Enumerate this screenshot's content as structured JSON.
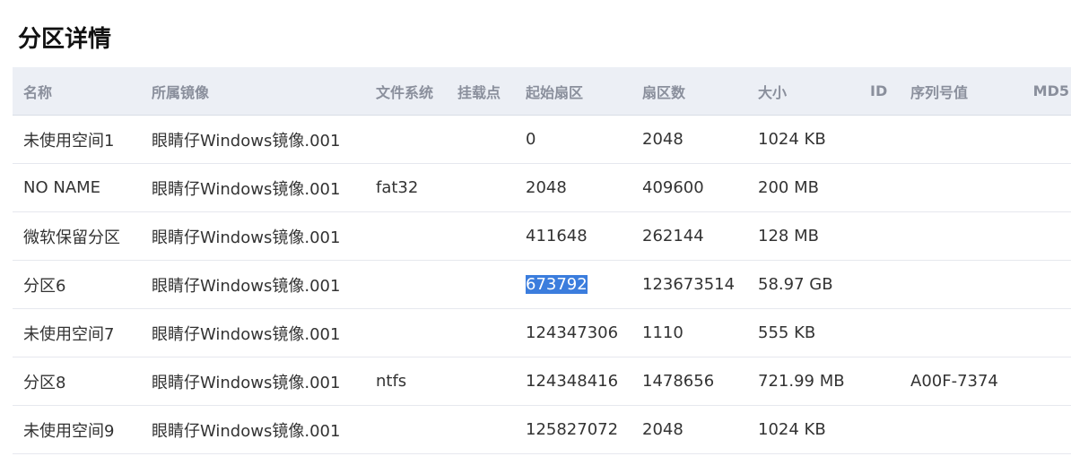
{
  "page": {
    "title": "分区详情"
  },
  "table": {
    "columns": [
      "名称",
      "所属镜像",
      "文件系统",
      "挂载点",
      "起始扇区",
      "扇区数",
      "大小",
      "ID",
      "序列号值",
      "MD5"
    ],
    "rows": [
      [
        "未使用空间1",
        "眼睛仔Windows镜像.001",
        "",
        "",
        "0",
        "2048",
        "1024 KB",
        "",
        "",
        ""
      ],
      [
        "NO NAME",
        "眼睛仔Windows镜像.001",
        "fat32",
        "",
        "2048",
        "409600",
        "200 MB",
        "",
        "",
        ""
      ],
      [
        "微软保留分区",
        "眼睛仔Windows镜像.001",
        "",
        "",
        "411648",
        "262144",
        "128 MB",
        "",
        "",
        ""
      ],
      [
        "分区6",
        "眼睛仔Windows镜像.001",
        "",
        "",
        "673792",
        "123673514",
        "58.97 GB",
        "",
        "",
        ""
      ],
      [
        "未使用空间7",
        "眼睛仔Windows镜像.001",
        "",
        "",
        "124347306",
        "1110",
        "555 KB",
        "",
        "",
        ""
      ],
      [
        "分区8",
        "眼睛仔Windows镜像.001",
        "ntfs",
        "",
        "124348416",
        "1478656",
        "721.99 MB",
        "",
        "A00F-7374",
        ""
      ],
      [
        "未使用空间9",
        "眼睛仔Windows镜像.001",
        "",
        "",
        "125827072",
        "2048",
        "1024 KB",
        "",
        "",
        ""
      ]
    ],
    "selected_text": {
      "row": 3,
      "col": 4
    }
  },
  "colors": {
    "header_bg": "#eceff5",
    "header_text": "#8a8f9c",
    "selection": "#3b7ddd"
  }
}
